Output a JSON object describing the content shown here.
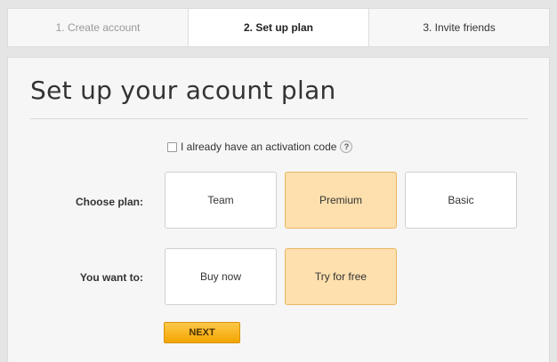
{
  "steps": [
    {
      "label": "1. Create account",
      "active": false
    },
    {
      "label": "2. Set up plan",
      "active": true
    },
    {
      "label": "3. Invite friends",
      "active": false
    }
  ],
  "title": "Set up your acount plan",
  "activation": {
    "label": "I already have an activation code",
    "checked": false,
    "help_icon": "?"
  },
  "plan": {
    "label": "Choose plan:",
    "options": [
      {
        "label": "Team",
        "selected": false
      },
      {
        "label": "Premium",
        "selected": true
      },
      {
        "label": "Basic",
        "selected": false
      }
    ]
  },
  "action": {
    "label": "You want to:",
    "options": [
      {
        "label": "Buy now",
        "selected": false
      },
      {
        "label": "Try for free",
        "selected": true
      }
    ]
  },
  "next_button": "NEXT",
  "colors": {
    "selected_fill": "#fde0ad",
    "selected_border": "#e9b766",
    "next_button": "#f7b51e"
  }
}
